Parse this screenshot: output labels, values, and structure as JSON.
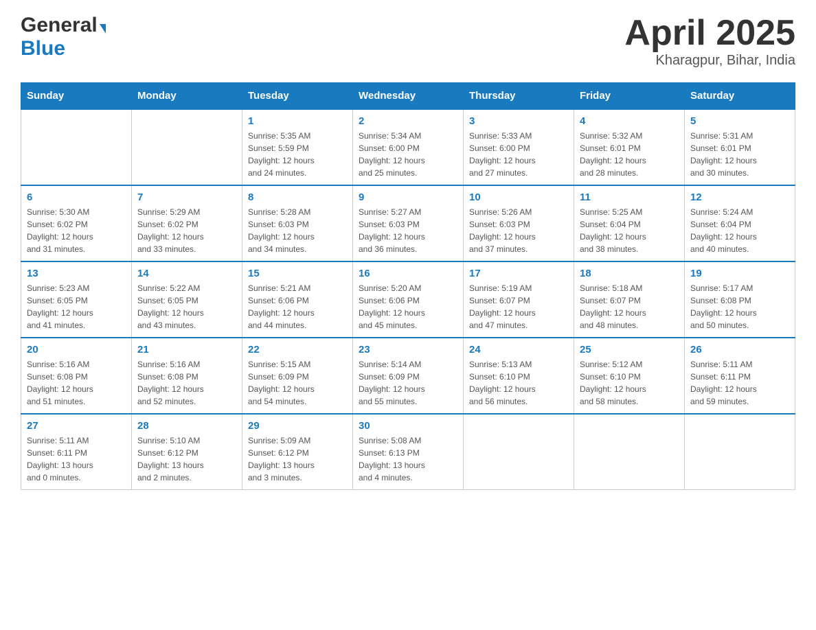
{
  "header": {
    "logo_general": "General",
    "logo_blue": "Blue",
    "month_title": "April 2025",
    "location": "Kharagpur, Bihar, India"
  },
  "weekdays": [
    "Sunday",
    "Monday",
    "Tuesday",
    "Wednesday",
    "Thursday",
    "Friday",
    "Saturday"
  ],
  "weeks": [
    [
      {
        "day": "",
        "info": ""
      },
      {
        "day": "",
        "info": ""
      },
      {
        "day": "1",
        "info": "Sunrise: 5:35 AM\nSunset: 5:59 PM\nDaylight: 12 hours\nand 24 minutes."
      },
      {
        "day": "2",
        "info": "Sunrise: 5:34 AM\nSunset: 6:00 PM\nDaylight: 12 hours\nand 25 minutes."
      },
      {
        "day": "3",
        "info": "Sunrise: 5:33 AM\nSunset: 6:00 PM\nDaylight: 12 hours\nand 27 minutes."
      },
      {
        "day": "4",
        "info": "Sunrise: 5:32 AM\nSunset: 6:01 PM\nDaylight: 12 hours\nand 28 minutes."
      },
      {
        "day": "5",
        "info": "Sunrise: 5:31 AM\nSunset: 6:01 PM\nDaylight: 12 hours\nand 30 minutes."
      }
    ],
    [
      {
        "day": "6",
        "info": "Sunrise: 5:30 AM\nSunset: 6:02 PM\nDaylight: 12 hours\nand 31 minutes."
      },
      {
        "day": "7",
        "info": "Sunrise: 5:29 AM\nSunset: 6:02 PM\nDaylight: 12 hours\nand 33 minutes."
      },
      {
        "day": "8",
        "info": "Sunrise: 5:28 AM\nSunset: 6:03 PM\nDaylight: 12 hours\nand 34 minutes."
      },
      {
        "day": "9",
        "info": "Sunrise: 5:27 AM\nSunset: 6:03 PM\nDaylight: 12 hours\nand 36 minutes."
      },
      {
        "day": "10",
        "info": "Sunrise: 5:26 AM\nSunset: 6:03 PM\nDaylight: 12 hours\nand 37 minutes."
      },
      {
        "day": "11",
        "info": "Sunrise: 5:25 AM\nSunset: 6:04 PM\nDaylight: 12 hours\nand 38 minutes."
      },
      {
        "day": "12",
        "info": "Sunrise: 5:24 AM\nSunset: 6:04 PM\nDaylight: 12 hours\nand 40 minutes."
      }
    ],
    [
      {
        "day": "13",
        "info": "Sunrise: 5:23 AM\nSunset: 6:05 PM\nDaylight: 12 hours\nand 41 minutes."
      },
      {
        "day": "14",
        "info": "Sunrise: 5:22 AM\nSunset: 6:05 PM\nDaylight: 12 hours\nand 43 minutes."
      },
      {
        "day": "15",
        "info": "Sunrise: 5:21 AM\nSunset: 6:06 PM\nDaylight: 12 hours\nand 44 minutes."
      },
      {
        "day": "16",
        "info": "Sunrise: 5:20 AM\nSunset: 6:06 PM\nDaylight: 12 hours\nand 45 minutes."
      },
      {
        "day": "17",
        "info": "Sunrise: 5:19 AM\nSunset: 6:07 PM\nDaylight: 12 hours\nand 47 minutes."
      },
      {
        "day": "18",
        "info": "Sunrise: 5:18 AM\nSunset: 6:07 PM\nDaylight: 12 hours\nand 48 minutes."
      },
      {
        "day": "19",
        "info": "Sunrise: 5:17 AM\nSunset: 6:08 PM\nDaylight: 12 hours\nand 50 minutes."
      }
    ],
    [
      {
        "day": "20",
        "info": "Sunrise: 5:16 AM\nSunset: 6:08 PM\nDaylight: 12 hours\nand 51 minutes."
      },
      {
        "day": "21",
        "info": "Sunrise: 5:16 AM\nSunset: 6:08 PM\nDaylight: 12 hours\nand 52 minutes."
      },
      {
        "day": "22",
        "info": "Sunrise: 5:15 AM\nSunset: 6:09 PM\nDaylight: 12 hours\nand 54 minutes."
      },
      {
        "day": "23",
        "info": "Sunrise: 5:14 AM\nSunset: 6:09 PM\nDaylight: 12 hours\nand 55 minutes."
      },
      {
        "day": "24",
        "info": "Sunrise: 5:13 AM\nSunset: 6:10 PM\nDaylight: 12 hours\nand 56 minutes."
      },
      {
        "day": "25",
        "info": "Sunrise: 5:12 AM\nSunset: 6:10 PM\nDaylight: 12 hours\nand 58 minutes."
      },
      {
        "day": "26",
        "info": "Sunrise: 5:11 AM\nSunset: 6:11 PM\nDaylight: 12 hours\nand 59 minutes."
      }
    ],
    [
      {
        "day": "27",
        "info": "Sunrise: 5:11 AM\nSunset: 6:11 PM\nDaylight: 13 hours\nand 0 minutes."
      },
      {
        "day": "28",
        "info": "Sunrise: 5:10 AM\nSunset: 6:12 PM\nDaylight: 13 hours\nand 2 minutes."
      },
      {
        "day": "29",
        "info": "Sunrise: 5:09 AM\nSunset: 6:12 PM\nDaylight: 13 hours\nand 3 minutes."
      },
      {
        "day": "30",
        "info": "Sunrise: 5:08 AM\nSunset: 6:13 PM\nDaylight: 13 hours\nand 4 minutes."
      },
      {
        "day": "",
        "info": ""
      },
      {
        "day": "",
        "info": ""
      },
      {
        "day": "",
        "info": ""
      }
    ]
  ]
}
